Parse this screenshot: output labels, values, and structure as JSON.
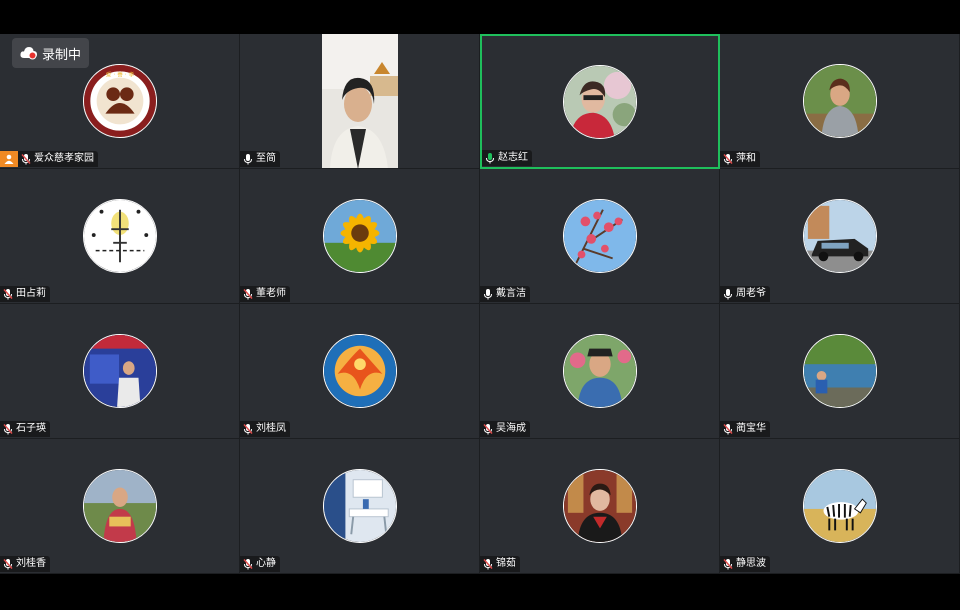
{
  "recording": {
    "label": "录制中",
    "icon": "cloud-record-icon",
    "dot_color": "#e8332f"
  },
  "colors": {
    "tile_bg": "#2b2e33",
    "active_border": "#1fbf5c",
    "host_badge": "#f08a24",
    "mic_muted": "#e04c4c",
    "mic_active": "#1fbf5c"
  },
  "participants": [
    {
      "name": "爱众慈孝家园",
      "mic": "muted",
      "host": true,
      "avatar": "logo"
    },
    {
      "name": "至简",
      "mic": "on",
      "host": false,
      "avatar": "video"
    },
    {
      "name": "赵志红",
      "mic": "speaking",
      "host": false,
      "avatar": "photo",
      "active": true
    },
    {
      "name": "萍和",
      "mic": "muted",
      "host": false,
      "avatar": "photo"
    },
    {
      "name": "田占莉",
      "mic": "muted",
      "host": false,
      "avatar": "calligraphy"
    },
    {
      "name": "董老师",
      "mic": "muted",
      "host": false,
      "avatar": "sunflower"
    },
    {
      "name": "戴言洁",
      "mic": "on",
      "host": false,
      "avatar": "blossom"
    },
    {
      "name": "周老爷",
      "mic": "on",
      "host": false,
      "avatar": "car"
    },
    {
      "name": "石子瑛",
      "mic": "muted",
      "host": false,
      "avatar": "stage"
    },
    {
      "name": "刘桂凤",
      "mic": "muted",
      "host": false,
      "avatar": "phoenix"
    },
    {
      "name": "吴海成",
      "mic": "muted",
      "host": false,
      "avatar": "portrait"
    },
    {
      "name": "蔺宝华",
      "mic": "muted",
      "host": false,
      "avatar": "lake"
    },
    {
      "name": "刘桂香",
      "mic": "muted",
      "host": false,
      "avatar": "field"
    },
    {
      "name": "心静",
      "mic": "muted",
      "host": false,
      "avatar": "room"
    },
    {
      "name": "锦茹",
      "mic": "muted",
      "host": false,
      "avatar": "portrait2"
    },
    {
      "name": "静思波",
      "mic": "muted",
      "host": false,
      "avatar": "zebra"
    }
  ]
}
